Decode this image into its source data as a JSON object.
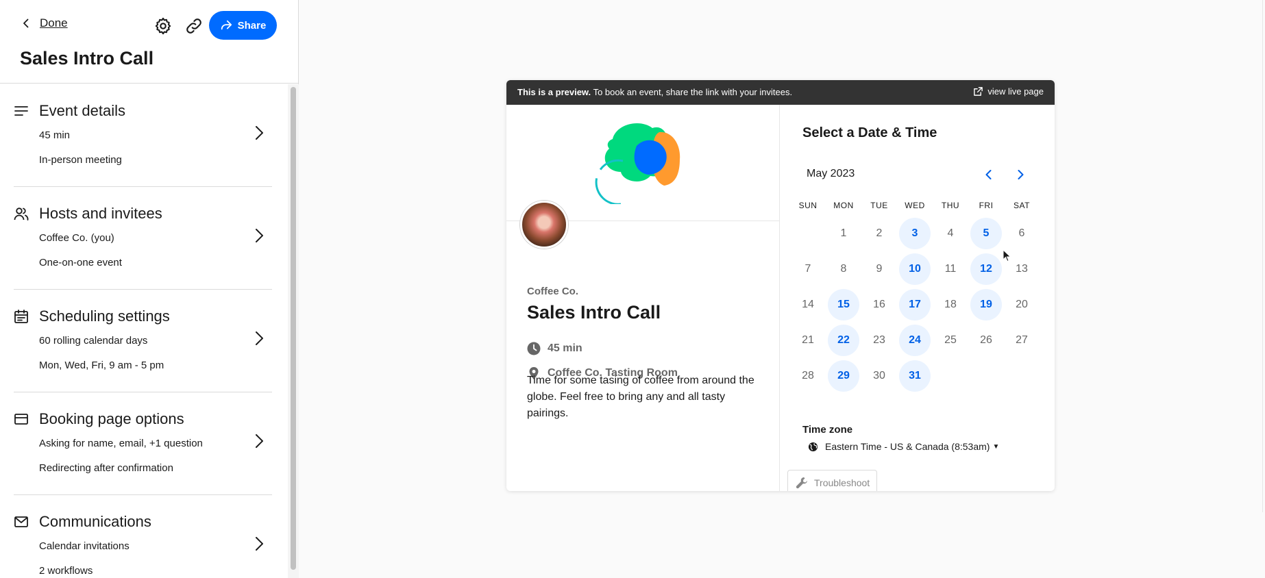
{
  "header": {
    "back_label": "Done",
    "title": "Sales Intro Call",
    "share_label": "Share",
    "icons": [
      "chevron-left-icon",
      "gear-icon",
      "link-icon",
      "share-arrow-icon"
    ]
  },
  "sidebar": {
    "sections": [
      {
        "title": "Event details",
        "icon": "lines-icon",
        "lines": [
          "45 min",
          "In-person meeting"
        ]
      },
      {
        "title": "Hosts and invitees",
        "icon": "people-icon",
        "lines": [
          "Coffee Co. (you)",
          "One-on-one event"
        ]
      },
      {
        "title": "Scheduling settings",
        "icon": "calendar-icon",
        "lines": [
          "60 rolling calendar days",
          "Mon, Wed, Fri, 9 am - 5 pm"
        ]
      },
      {
        "title": "Booking page options",
        "icon": "card-icon",
        "lines": [
          "Asking for name, email, +1 question",
          "Redirecting after confirmation"
        ]
      },
      {
        "title": "Communications",
        "icon": "mail-icon",
        "lines": [
          "Calendar invitations",
          "2 workflows"
        ]
      }
    ]
  },
  "preview": {
    "banner_bold": "This is a preview.",
    "banner_text": " To book an event, share the link with your invitees.",
    "view_live": "view live page",
    "org": "Coffee Co.",
    "event_title": "Sales Intro Call",
    "duration": "45 min",
    "location": "Coffee Co. Tasting Room",
    "description": "Time for some tasing of coffee from around the globe. Feel free to bring any and all tasty pairings.",
    "select_title": "Select a Date & Time",
    "month": "May 2023",
    "weekdays": [
      "SUN",
      "MON",
      "TUE",
      "WED",
      "THU",
      "FRI",
      "SAT"
    ],
    "weeks": [
      [
        "",
        "1",
        "2",
        "3",
        "4",
        "5",
        "6"
      ],
      [
        "7",
        "8",
        "9",
        "10",
        "11",
        "12",
        "13"
      ],
      [
        "14",
        "15",
        "16",
        "17",
        "18",
        "19",
        "20"
      ],
      [
        "21",
        "22",
        "23",
        "24",
        "25",
        "26",
        "27"
      ],
      [
        "28",
        "29",
        "30",
        "31",
        "",
        "",
        ""
      ]
    ],
    "available_days": [
      "3",
      "5",
      "10",
      "12",
      "15",
      "17",
      "19",
      "22",
      "24",
      "29",
      "31"
    ],
    "timezone_label": "Time zone",
    "timezone": "Eastern Time - US & Canada (8:53am)",
    "troubleshoot": "Troubleshoot",
    "colors": {
      "accent": "#006bff",
      "available_bg": "#eaf3ff",
      "blob_green": "#00d97e",
      "blob_blue": "#006bff",
      "blob_orange": "#ff9a2e"
    }
  }
}
